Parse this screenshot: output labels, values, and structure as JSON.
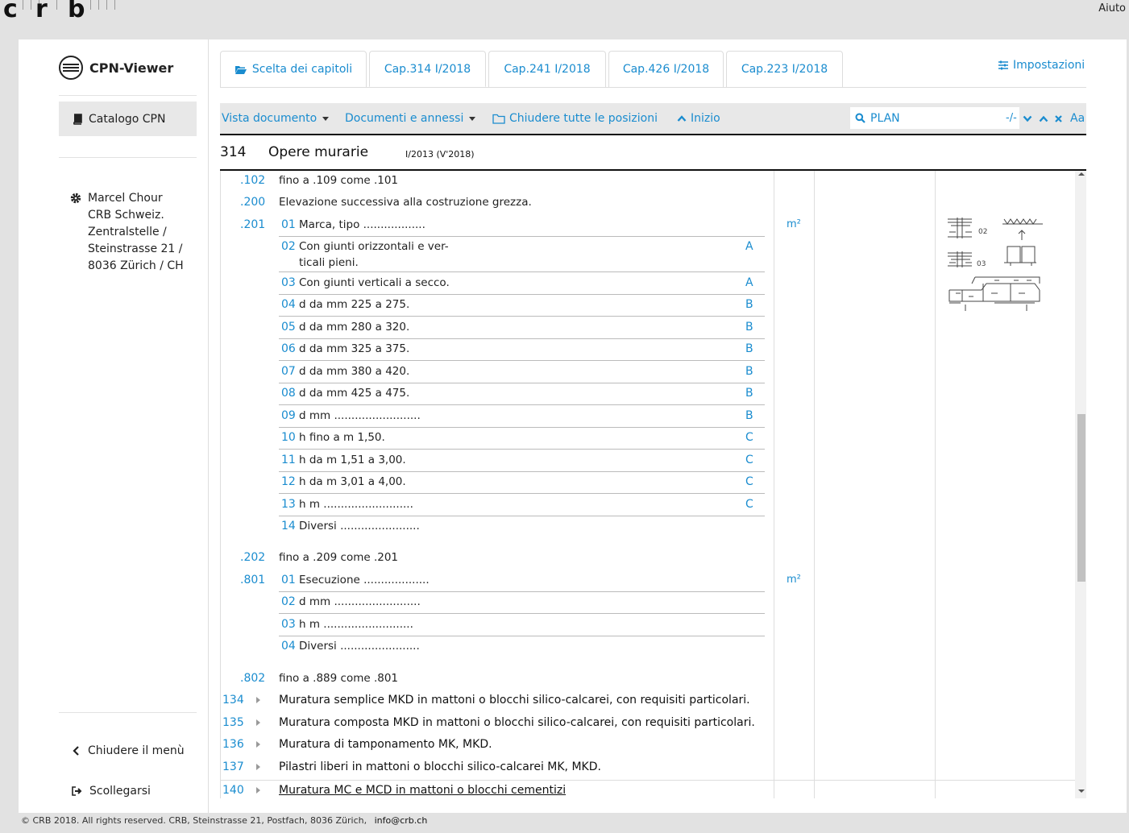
{
  "header": {
    "logo_letters": [
      "c",
      "r",
      "b"
    ],
    "help": "Aiuto"
  },
  "sidebar": {
    "app_title": "CPN-Viewer",
    "catalog": "Catalogo CPN",
    "user_lines": [
      "Marcel Chour",
      "CRB Schweiz.",
      "Zentralstelle /",
      "Steinstrasse 21 /",
      "8036 Zürich / CH"
    ],
    "close_menu": "Chiudere il menù",
    "logout": "Scollegarsi"
  },
  "tabs": [
    {
      "label": "Scelta dei capitoli",
      "icon": "folder-open-icon"
    },
    {
      "label": "Cap.314 I/2018"
    },
    {
      "label": "Cap.241 I/2018"
    },
    {
      "label": "Cap.426 I/2018"
    },
    {
      "label": "Cap.223 I/2018"
    }
  ],
  "settings": "Impostazioni",
  "toolbar": {
    "view": "Vista documento",
    "docs": "Documenti e annessi",
    "close_all": "Chiudere tutte le posizioni",
    "home": "Inizio",
    "search_value": "PLAN",
    "search_count": "-/-",
    "case": "Aa"
  },
  "chapter": {
    "number": "314",
    "title": "Opere murarie",
    "version": "I/2013 (V'2018)"
  },
  "rows": {
    "r102": {
      "pos": ".102",
      "text": "fino a .109 come .101"
    },
    "r200": {
      "pos": ".200",
      "text": "Elevazione successiva alla costruzione grezza."
    },
    "r201": {
      "pos": ".201",
      "unit": "m²"
    },
    "r202": {
      "pos": ".202",
      "text": "fino a .209 come .201"
    },
    "r801": {
      "pos": ".801",
      "unit": "m²"
    },
    "r802": {
      "pos": ".802",
      "text": "fino a .889 come .801"
    }
  },
  "sub201": [
    {
      "n": "01",
      "t": "Marca, tipo ..................",
      "g": ""
    },
    {
      "n": "02",
      "t": "Con giunti orizzontali e ver-",
      "t2": "ticali pieni.",
      "g": "A"
    },
    {
      "n": "03",
      "t": "Con giunti verticali a secco.",
      "g": "A"
    },
    {
      "n": "04",
      "t": "d da mm 225 a 275.",
      "g": "B"
    },
    {
      "n": "05",
      "t": "d da mm 280 a 320.",
      "g": "B"
    },
    {
      "n": "06",
      "t": "d da mm 325 a 375.",
      "g": "B"
    },
    {
      "n": "07",
      "t": "d da mm 380 a 420.",
      "g": "B"
    },
    {
      "n": "08",
      "t": "d da mm 425 a 475.",
      "g": "B"
    },
    {
      "n": "09",
      "t": "d mm .........................",
      "g": "B"
    },
    {
      "n": "10",
      "t": "h fino a m 1,50.",
      "g": "C"
    },
    {
      "n": "11",
      "t": "h da m 1,51 a 3,00.",
      "g": "C"
    },
    {
      "n": "12",
      "t": "h da m 3,01 a 4,00.",
      "g": "C"
    },
    {
      "n": "13",
      "t": "h m ..........................",
      "g": "C"
    },
    {
      "n": "14",
      "t": "Diversi .......................",
      "g": ""
    }
  ],
  "sub801": [
    {
      "n": "01",
      "t": "Esecuzione ..................."
    },
    {
      "n": "02",
      "t": "d mm ........................."
    },
    {
      "n": "03",
      "t": "h m .........................."
    },
    {
      "n": "04",
      "t": "Diversi ......................."
    }
  ],
  "sections": [
    {
      "n": "134",
      "t": "Muratura semplice MKD in mattoni o blocchi silico-calcarei, con requisiti particolari."
    },
    {
      "n": "135",
      "t": "Muratura composta MKD in mattoni o blocchi silico-calcarei, con requisiti particolari."
    },
    {
      "n": "136",
      "t": "Muratura di tamponamento MK, MKD."
    },
    {
      "n": "137",
      "t": "Pilastri liberi in mattoni o blocchi silico-calcarei MK, MKD."
    },
    {
      "n": "140",
      "t": "Muratura MC e MCD in mattoni o blocchi cementizi"
    }
  ],
  "sketch_labels": [
    "02",
    "03"
  ],
  "footer": {
    "copyright": "© CRB 2018. All rights reserved. CRB, Steinstrasse 21, Postfach, 8036 Zürich,",
    "email": "info@crb.ch"
  }
}
